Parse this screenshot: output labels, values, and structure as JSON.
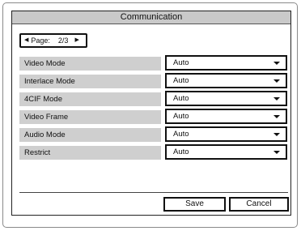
{
  "dialog": {
    "title": "Communication"
  },
  "pager": {
    "label": "Page:",
    "value": "2/3",
    "prev_icon": "triangle-left-icon",
    "next_icon": "triangle-right-icon"
  },
  "settings": [
    {
      "label": "Video Mode",
      "value": "Auto"
    },
    {
      "label": "Interlace Mode",
      "value": "Auto"
    },
    {
      "label": "4CIF Mode",
      "value": "Auto"
    },
    {
      "label": "Video Frame",
      "value": "Auto"
    },
    {
      "label": "Audio Mode",
      "value": "Auto"
    },
    {
      "label": "Restrict",
      "value": "Auto"
    }
  ],
  "buttons": {
    "save": "Save",
    "cancel": "Cancel"
  }
}
